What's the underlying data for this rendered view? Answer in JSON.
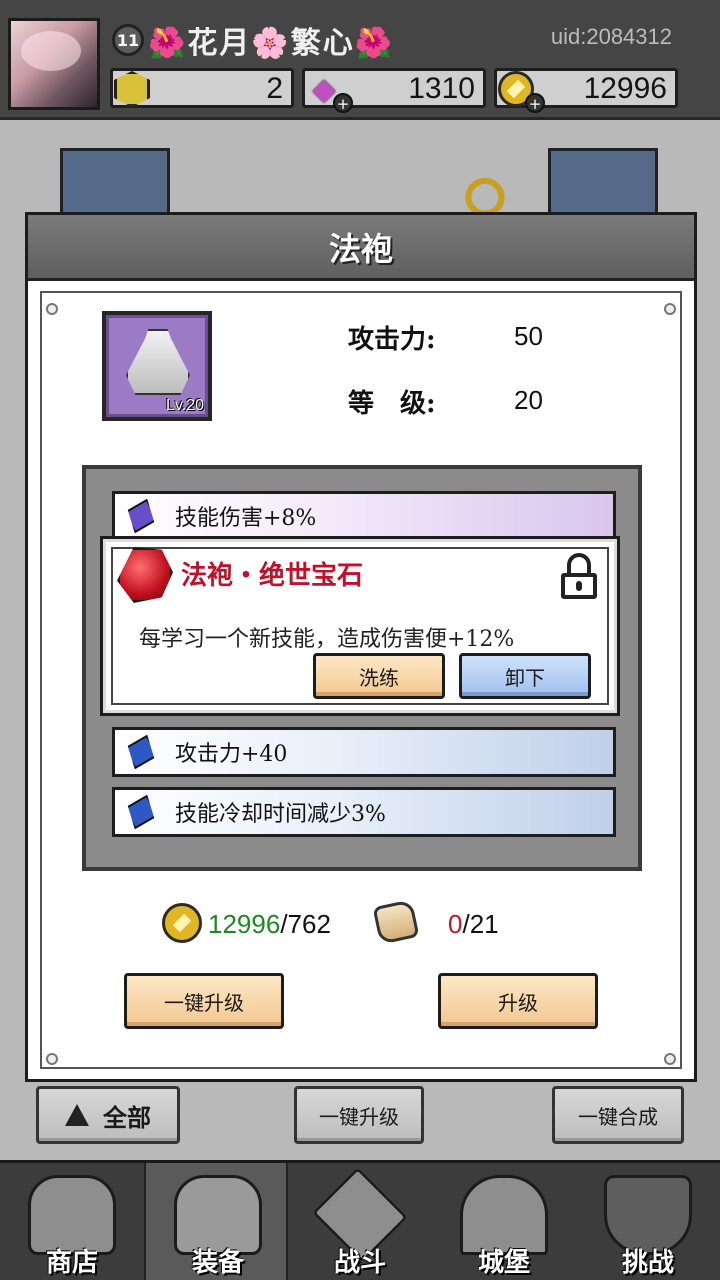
{
  "header": {
    "level": "11",
    "player_name": "🌺花月🌸繁心🌺",
    "uid": "uid:2084312",
    "resources": [
      {
        "icon": "gem-icon",
        "value": "2"
      },
      {
        "icon": "diamond-icon",
        "value": "1310"
      },
      {
        "icon": "coin-icon",
        "value": "12996"
      }
    ]
  },
  "modal": {
    "title": "法袍",
    "item": {
      "level_label": "Lv.20",
      "icon": "robe-icon"
    },
    "stats": [
      {
        "label": "攻击力:",
        "value": "50"
      },
      {
        "label": "等　级:",
        "value": "20"
      }
    ],
    "gem_rows": [
      {
        "text": "技能伤害+8%",
        "color": "#6a4ec9"
      },
      {
        "text": "攻击力+40",
        "color": "#2e58c2"
      },
      {
        "text": "技能冷却时间减少3%",
        "color": "#2e58c2"
      }
    ],
    "popup": {
      "title": "法袍・绝世宝石",
      "description": "每学习一个新技能，造成伤害便+12%",
      "refine_label": "洗练",
      "unequip_label": "卸下"
    },
    "cost": {
      "coins_have": "12996",
      "coins_need": "/762",
      "scrolls_have": "0",
      "scrolls_need": "/21"
    },
    "one_click_upgrade_label": "一键升级",
    "upgrade_label": "升级"
  },
  "filters": {
    "all_label": "全部",
    "one_click_upgrade_label": "一键升级",
    "one_click_merge_label": "一键合成"
  },
  "nav": [
    {
      "label": "商店"
    },
    {
      "label": "装备"
    },
    {
      "label": "战斗"
    },
    {
      "label": "城堡"
    },
    {
      "label": "挑战"
    }
  ],
  "colors": {
    "accent_red": "#c0102a",
    "coin_green": "#1e8a1e",
    "item_bg_purple": "#9b7bc5"
  }
}
